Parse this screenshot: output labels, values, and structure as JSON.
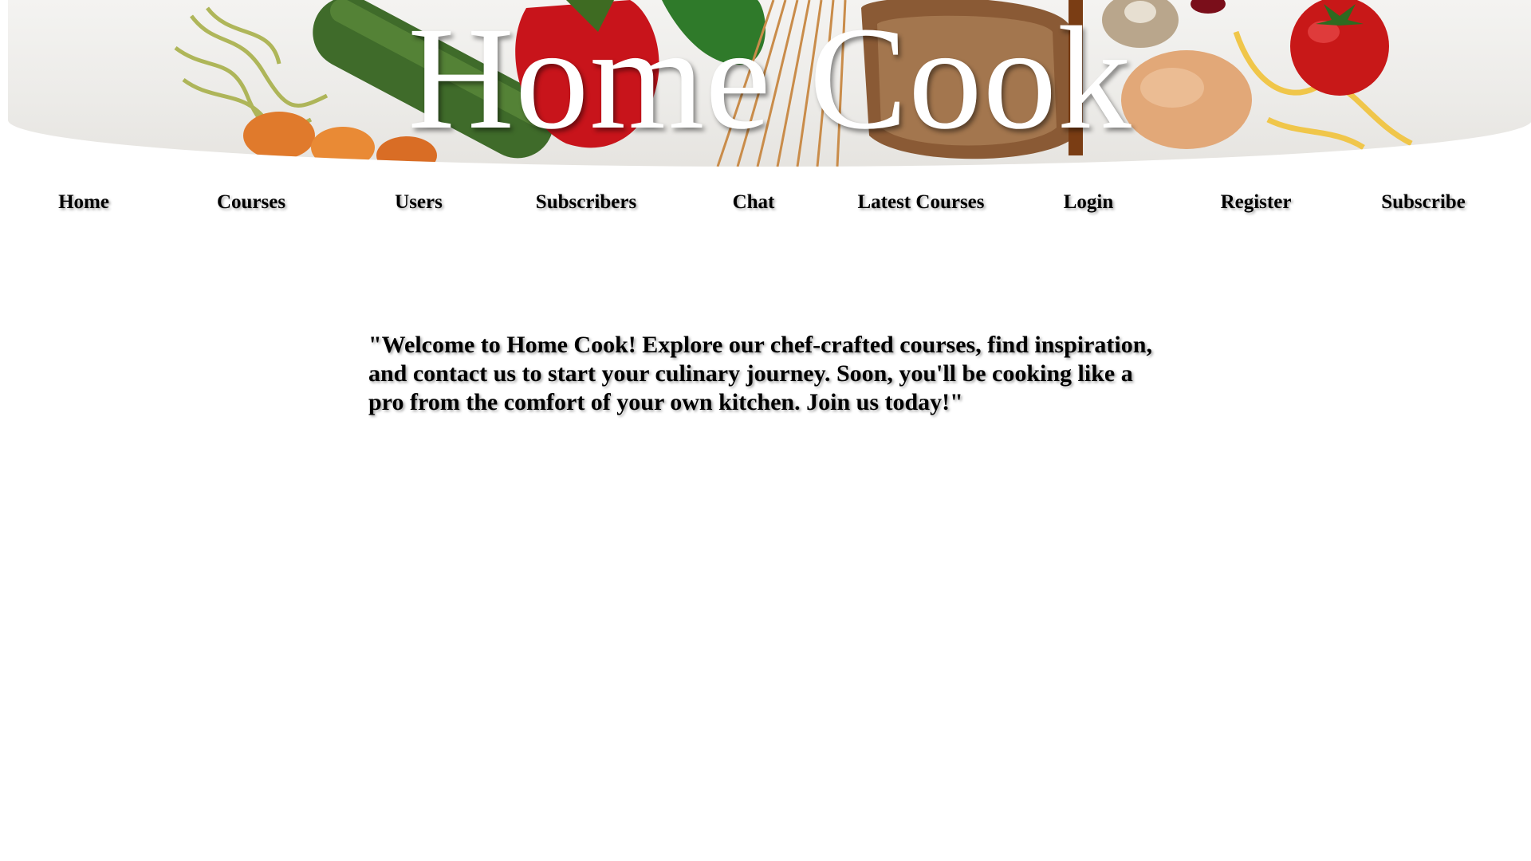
{
  "banner": {
    "title": "Home Cook"
  },
  "nav": {
    "items": [
      {
        "label": "Home"
      },
      {
        "label": "Courses"
      },
      {
        "label": "Users"
      },
      {
        "label": "Subscribers"
      },
      {
        "label": "Chat"
      },
      {
        "label": "Latest Courses"
      },
      {
        "label": "Login"
      },
      {
        "label": "Register"
      },
      {
        "label": "Subscribe"
      }
    ]
  },
  "main": {
    "welcome_text": "\"Welcome to Home Cook! Explore our chef-crafted courses, find inspiration, and contact us to start your culinary journey. Soon, you'll be cooking like a pro from the comfort of your own kitchen. Join us today!\""
  },
  "colors": {
    "background": "#ffffff",
    "text": "#000000",
    "banner_title": "#ffffff"
  }
}
